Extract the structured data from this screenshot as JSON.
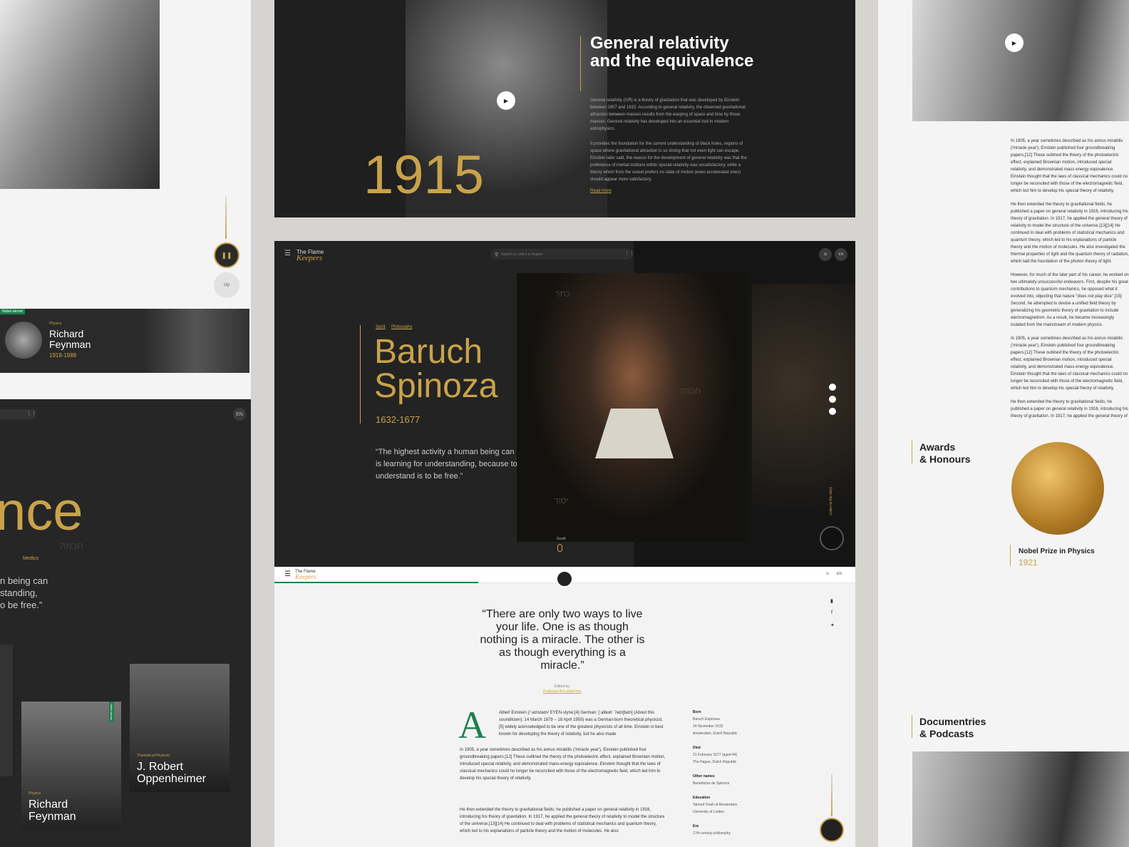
{
  "left": {
    "feynman_card": {
      "badge": "Nobel winner",
      "category": "Physics",
      "name": "Richard Feynman",
      "years": "1918-1988"
    },
    "player": {
      "up_label": "Up"
    },
    "dark": {
      "lang": "EN",
      "big_fragment": "nce",
      "tag": "Medics",
      "quote_fragment": "n being can\nstanding,\no be free.”",
      "hebrew": "חכמה"
    },
    "cards": [
      {
        "category": "Physics",
        "name": "Richard Feynman",
        "badge": "Nobel winner"
      },
      {
        "category": "Theoretical Physicist",
        "name": "J. Robert Oppenheimer"
      }
    ]
  },
  "hero1915": {
    "year": "1915",
    "title": "General relativity and the equivalence",
    "para1": "General relativity (GR) is a theory of gravitation that was developed by Einstein between 1907 and 1915. According to general relativity, the observed gravitational attraction between masses results from the warping of space and time by those masses. General relativity has developed into an essential tool in modern astrophysics.",
    "para2": "It provides the foundation for the current understanding of black holes, regions of space where gravitational attraction is so strong that not even light can escape. Einstein later said, the reason for the development of general relativity was that the preference of inertial motions within special relativity was unsatisfactory, while a theory which from the outset prefers no state of motion (even accelerated ones) should appear more satisfactory.",
    "read_more": "Read more"
  },
  "spinoza": {
    "brand_line1": "The Flame",
    "brand_line2": "Keepers",
    "search_placeholder": "Search or select a chapter",
    "lang": "EN",
    "tags": [
      "Spirit",
      "Philosophy"
    ],
    "name_line1": "Baruch",
    "name_line2": "Spinoza",
    "years": "1632-1677",
    "quote": "“The highest activity a human being can attain is learning for understanding, because to understand is to be free.”",
    "scroll": "Scroll",
    "listen": "Listen to the story",
    "hebrew_top": "כתר",
    "hebrew_mid": "חכמה",
    "hebrew_bot": "יסוד"
  },
  "article": {
    "brand_line1": "The Flame",
    "brand_line2": "Keepers",
    "lang": "EN",
    "quote": "“There are only two ways to live your life. One is as though nothing is a miracle. The other is as though everything is a miracle.”",
    "edited_by": "Edited by:",
    "editor": "Professor Ari Lieberman",
    "dropcap": "A",
    "p1": "Albert Einstein (/ˈaɪnstaɪn/ EYEN-styne;[4] German: [ˈalbɛɐt ˈʔaɪnʃtaɪn] (About this soundlisten); 14 March 1879 – 18 April 1955) was a German-born theoretical physicist,[5] widely acknowledged to be one of the greatest physicists of all time. Einstein is best known for developing the theory of relativity, but he also made",
    "p2": "In 1905, a year sometimes described as his annus mirabilis ('miracle year'), Einstein published four groundbreaking papers.[12] These outlined the theory of the photoelectric effect, explained Brownian motion, introduced special relativity, and demonstrated mass-energy equivalence. Einstein thought that the laws of classical mechanics could no longer be reconciled with those of the electromagnetic field, which led him to develop his special theory of relativity.",
    "p3": "He then extended the theory to gravitational fields; he published a paper on general relativity in 1916, introducing his theory of gravitation. In 1917, he applied the general theory of relativity to model the structure of the universe.[13][14] He continued to deal with problems of statistical mechanics and quantum theory, which led to his explanations of particle theory and the motion of molecules. He also",
    "facts": [
      {
        "label": "Born",
        "lines": [
          "Baruch Espinosa",
          "24 November 1632",
          "Amsterdam, Dutch Republic"
        ]
      },
      {
        "label": "Died",
        "lines": [
          "21 February 1677 (aged 44)",
          "The Hague, Dutch Republic"
        ]
      },
      {
        "label": "Other names",
        "lines": [
          "Benedictus de Spinoza"
        ]
      },
      {
        "label": "Education",
        "lines": [
          "Talmud Torah of Amsterdam",
          "University of Leiden"
        ]
      },
      {
        "label": "Era",
        "lines": [
          "17th-century philosophy"
        ]
      }
    ]
  },
  "right": {
    "paragraphs": [
      "In 1905, a year sometimes described as his annus mirabilis ('miracle year'), Einstein published four groundbreaking papers.[12] These outlined the theory of the photoelectric effect, explained Brownian motion, introduced special relativity, and demonstrated mass-energy equivalence. Einstein thought that the laws of classical mechanics could no longer be reconciled with those of the electromagnetic field, which led him to develop his special theory of relativity.",
      "He then extended the theory to gravitational fields; he published a paper on general relativity in 1916, introducing his theory of gravitation. In 1917, he applied the general theory of relativity to model the structure of the universe.[13][14] He continued to deal with problems of statistical mechanics and quantum theory, which led to his explanations of particle theory and the motion of molecules. He also investigated the thermal properties of light and the quantum theory of radiation, which laid the foundation of the photon theory of light.",
      "However, for much of the later part of his career, he worked on two ultimately unsuccessful endeavors. First, despite his great contributions to quantum mechanics, he opposed what it evolved into, objecting that nature \"does not play dice\".[15] Second, he attempted to devise a unified field theory by generalizing his geometric theory of gravitation to include electromagnetism. As a result, he became increasingly isolated from the mainstream of modern physics.",
      "In 1905, a year sometimes described as his annus mirabilis ('miracle year'), Einstein published four groundbreaking papers.[12] These outlined the theory of the photoelectric effect, explained Brownian motion, introduced special relativity, and demonstrated mass-energy equivalence. Einstein thought that the laws of classical mechanics could no longer be reconciled with those of the electromagnetic field, which led him to develop his special theory of relativity.",
      "He then extended the theory to gravitational fields; he published a paper on general relativity in 1916, introducing his theory of gravitation. In 1917, he applied the general theory of relativity to model the structure of the universe.[13][14] He continued to deal with problems of statistical mechanics and quantum theory, which led to his explanations of particle theory and the motion of molecules. He also investigated the thermal properties of light and the quantum theory of radiation, which laid the foundation of the photon theory of light."
    ],
    "awards_line1": "Awards",
    "awards_line2": "& Honours",
    "award_name": "Nobel Prize in Physics",
    "award_year": "1921",
    "docs_line1": "Documentries",
    "docs_line2": "& Podcasts"
  }
}
